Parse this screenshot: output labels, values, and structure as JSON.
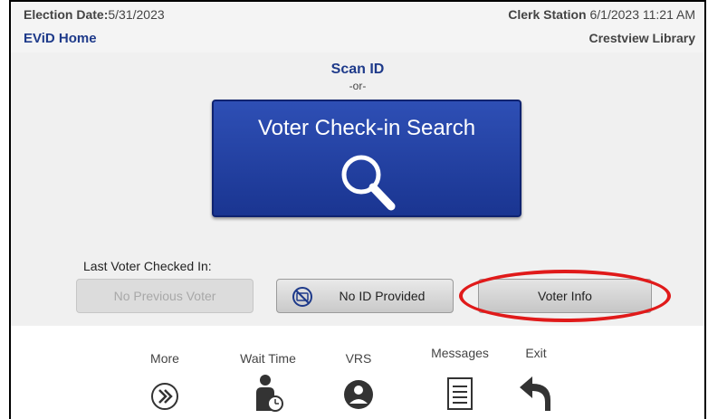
{
  "header": {
    "election_label": "Election Date:",
    "election_date": "5/31/2023",
    "home_link": "EViD Home",
    "station_label": "Clerk Station",
    "station_datetime": "6/1/2023 11:21 AM",
    "location": "Crestview Library"
  },
  "main": {
    "scan_id": "Scan ID",
    "or": "-or-",
    "search_button": "Voter Check-in Search",
    "last_checked_label": "Last Voter Checked In:",
    "no_previous_voter": "No Previous Voter",
    "no_id_provided": "No ID Provided",
    "voter_info": "Voter Info"
  },
  "footer": {
    "more": "More",
    "wait_time": "Wait Time",
    "vrs": "VRS",
    "messages": "Messages",
    "exit": "Exit"
  },
  "colors": {
    "navy": "#1e3a8a",
    "button_blue": "#1a3591",
    "highlight_red": "#e01a1a"
  },
  "icons": [
    "search-icon",
    "no-id-icon",
    "more-icon",
    "wait-time-icon",
    "vrs-icon",
    "messages-icon",
    "exit-icon"
  ]
}
